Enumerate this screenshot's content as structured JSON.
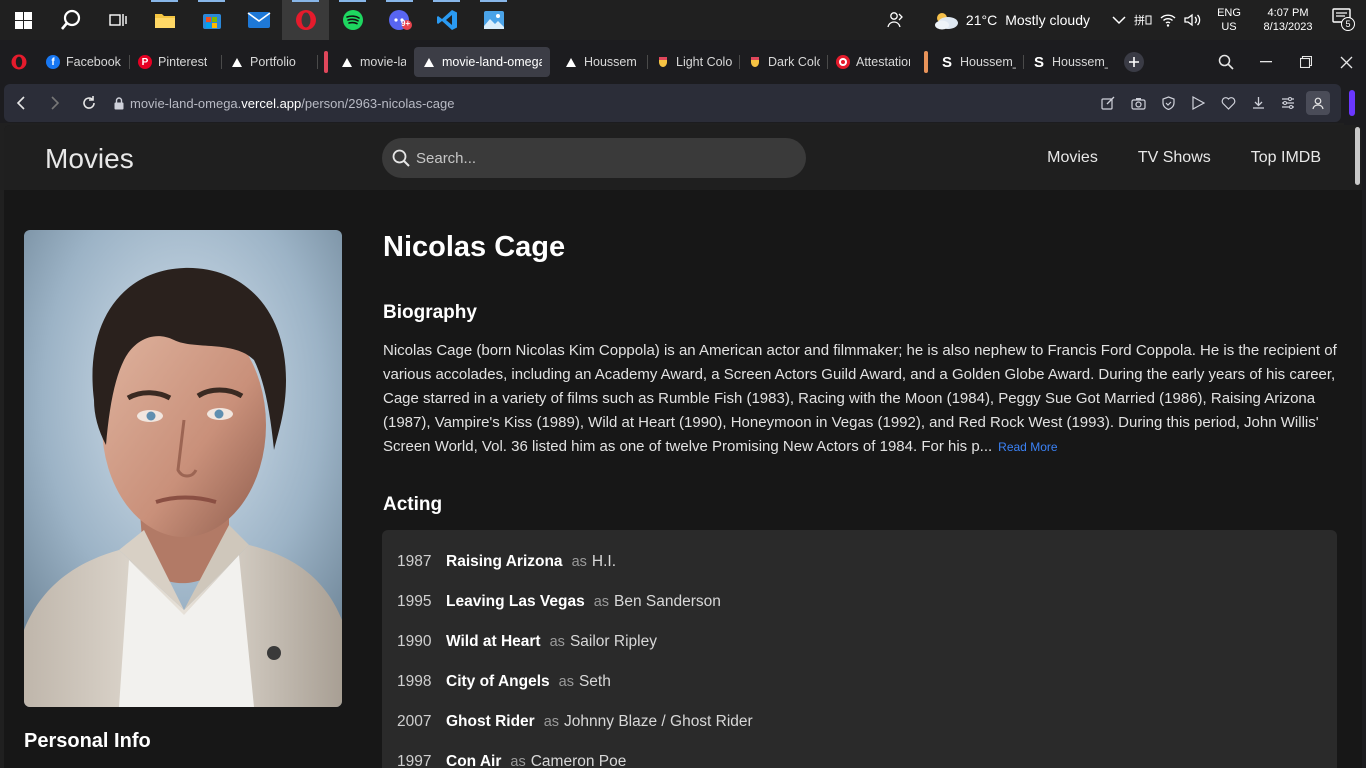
{
  "taskbar": {
    "apps": [
      "start-icon",
      "search-icon",
      "task-view-icon",
      "file-explorer-icon",
      "microsoft-store-icon",
      "mail-icon",
      "opera-icon",
      "spotify-icon",
      "discord-icon",
      "vscode-icon",
      "photos-icon"
    ],
    "discord_badge": "9+",
    "weather": {
      "temp": "21°C",
      "condition": "Mostly cloudy"
    },
    "language": "ENG",
    "region": "US",
    "time": "4:07 PM",
    "date": "8/13/2023",
    "notification_count": "5"
  },
  "browser": {
    "tabs": [
      {
        "label": "Facebook",
        "icon": "facebook-icon"
      },
      {
        "label": "Pinterest",
        "icon": "pinterest-icon"
      },
      {
        "label": "Portfolio",
        "icon": "vercel-icon"
      },
      {
        "label": "movie-land",
        "icon": "vercel-icon"
      },
      {
        "label": "movie-land-omega",
        "icon": "vercel-icon"
      },
      {
        "label": "Houssem P",
        "icon": "vercel-icon"
      },
      {
        "label": "Light Color",
        "icon": "theme-icon"
      },
      {
        "label": "Dark Color",
        "icon": "theme-icon"
      },
      {
        "label": "Attestation",
        "icon": "target-icon"
      },
      {
        "label": "Houssem_F",
        "icon": "s-icon"
      },
      {
        "label": "Houssem_F",
        "icon": "s-icon"
      }
    ],
    "colors": {
      "group_red": "#e0475b",
      "group_orange": "#e8935a",
      "sidebar_accent": "#6b37ff"
    },
    "url_prefix": "movie-land-omega.",
    "url_domain": "vercel.app",
    "url_path": "/person/2963-nicolas-cage"
  },
  "site": {
    "brand": "Movies",
    "search_placeholder": "Search...",
    "nav": [
      "Movies",
      "TV Shows",
      "Top IMDB"
    ],
    "person": {
      "name": "Nicolas Cage",
      "biography_title": "Biography",
      "biography": "Nicolas Cage (born Nicolas Kim Coppola) is an American actor and filmmaker; he is also nephew to Francis Ford Coppola. He is the recipient of various accolades, including an Academy Award, a Screen Actors Guild Award, and a Golden Globe Award. During the early years of his career, Cage starred in a variety of films such as Rumble Fish (1983), Racing with the Moon (1984), Peggy Sue Got Married (1986), Raising Arizona (1987), Vampire's Kiss (1989), Wild at Heart (1990), Honeymoon in Vegas (1992), and Red Rock West (1993). During this period, John Willis' Screen World, Vol. 36 listed him as one of twelve Promising New Actors of 1984. For his p...",
      "read_more": "Read More",
      "acting_title": "Acting",
      "personal_info_title": "Personal Info",
      "as_word": "as",
      "credits": [
        {
          "year": "1987",
          "title": "Raising Arizona",
          "character": "H.I."
        },
        {
          "year": "1995",
          "title": "Leaving Las Vegas",
          "character": "Ben Sanderson"
        },
        {
          "year": "1990",
          "title": "Wild at Heart",
          "character": "Sailor Ripley"
        },
        {
          "year": "1998",
          "title": "City of Angels",
          "character": "Seth"
        },
        {
          "year": "2007",
          "title": "Ghost Rider",
          "character": "Johnny Blaze / Ghost Rider"
        },
        {
          "year": "1997",
          "title": "Con Air",
          "character": "Cameron Poe"
        }
      ]
    }
  }
}
